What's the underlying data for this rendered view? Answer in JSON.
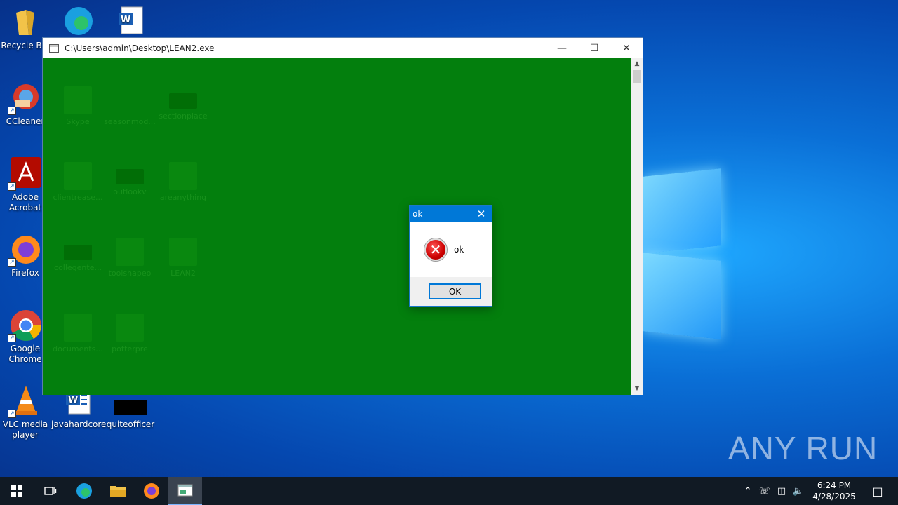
{
  "desktop": {
    "icons": [
      {
        "label": "Recycle Bin",
        "icon": "recycle-bin-icon"
      },
      {
        "label": "CCleaner",
        "icon": "ccleaner-icon"
      },
      {
        "label": "Adobe Acrobat",
        "icon": "adobe-acrobat-icon"
      },
      {
        "label": "Firefox",
        "icon": "firefox-icon"
      },
      {
        "label": "Google Chrome",
        "icon": "chrome-icon"
      },
      {
        "label": "VLC media player",
        "icon": "vlc-icon"
      },
      {
        "label": "javahardcore",
        "icon": "word-doc-icon"
      },
      {
        "label": "quiteofficer",
        "icon": "black-file-icon"
      }
    ],
    "ghost_icons": [
      "Skype",
      "seasonmod...",
      "sectionplace",
      "clientrease...",
      "outlookv",
      "areanything",
      "collegente...",
      "toolshapeo",
      "LEAN2",
      "documents...",
      "potterpre"
    ]
  },
  "window": {
    "title": "C:\\Users\\admin\\Desktop\\LEAN2.exe",
    "client_color": "#037f0d"
  },
  "dialog": {
    "title": "ok",
    "message": "ok",
    "ok_label": "OK",
    "icon": "error-icon"
  },
  "watermark": "ANY RUN",
  "taskbar": {
    "items": [
      "start-icon",
      "task-view-icon",
      "edge-icon",
      "file-explorer-icon",
      "firefox-icon",
      "lean2-app-icon"
    ],
    "time": "6:24 PM",
    "date": "4/28/2025"
  },
  "colors": {
    "accent": "#0078d7",
    "taskbar": "#111a24",
    "green": "#037f0d"
  }
}
